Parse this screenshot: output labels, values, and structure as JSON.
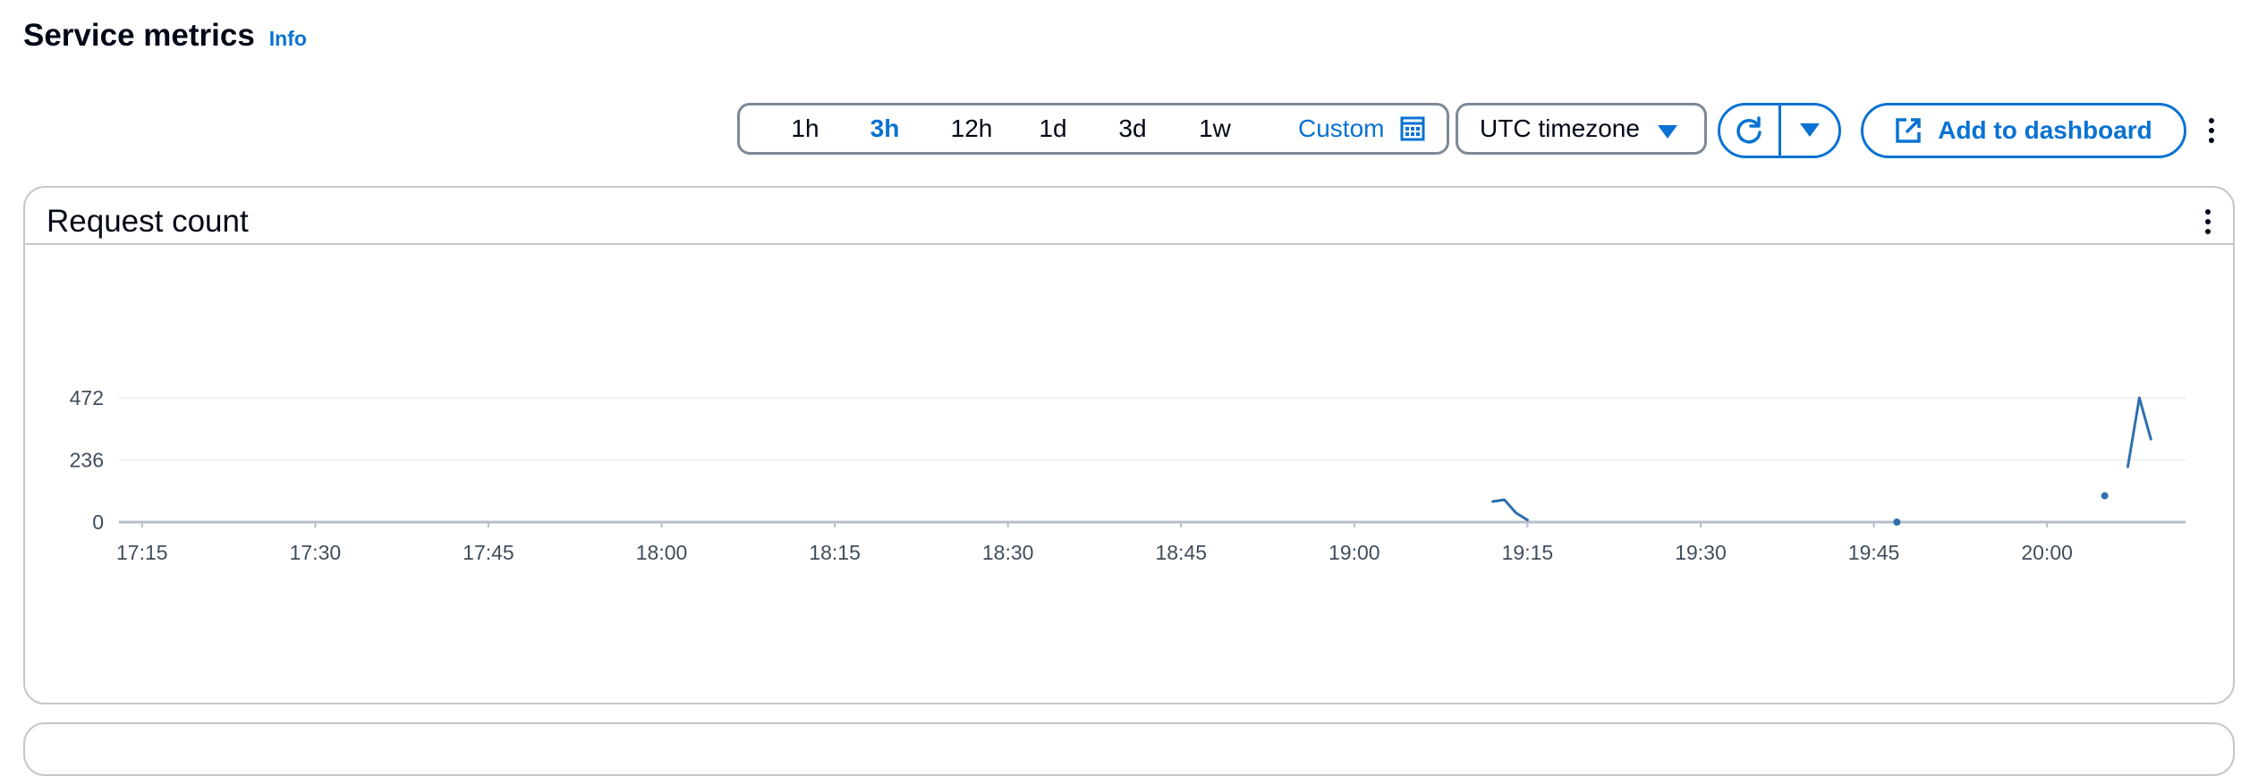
{
  "header": {
    "title": "Service metrics",
    "info": "Info"
  },
  "time_range": {
    "options": [
      "1h",
      "3h",
      "12h",
      "1d",
      "3d",
      "1w"
    ],
    "selected": "3h",
    "custom_label": "Custom"
  },
  "timezone": {
    "value": "UTC timezone"
  },
  "toolbar": {
    "add_to_dashboard": "Add to dashboard"
  },
  "icons": {
    "calendar": "calendar-icon",
    "caret": "caret-down-icon",
    "refresh": "refresh-icon",
    "external": "external-link-icon",
    "more": "more-vertical-icon"
  },
  "colors": {
    "accent": "#0972d3",
    "series": "#2e6fad",
    "border": "#7d8998"
  },
  "widget": {
    "title": "Request count",
    "chart_data": {
      "type": "line",
      "x_ticks": [
        "17:15",
        "17:30",
        "17:45",
        "18:00",
        "18:15",
        "18:30",
        "18:45",
        "19:00",
        "19:15",
        "19:30",
        "19:45",
        "20:00"
      ],
      "y_ticks": [
        "0",
        "236",
        "472"
      ],
      "ylim": [
        0,
        472
      ],
      "xlim": [
        "17:13",
        "20:12"
      ],
      "grid": true,
      "series": [
        {
          "segments": [
            [
              [
                "19:12",
                78
              ],
              [
                "19:13",
                85
              ],
              [
                "19:14",
                35
              ],
              [
                "19:15",
                8
              ]
            ],
            [
              [
                "19:47",
                0
              ]
            ],
            [
              [
                "20:05",
                100
              ]
            ],
            [
              [
                "20:07",
                210
              ],
              [
                "20:08",
                472
              ],
              [
                "20:09",
                315
              ]
            ]
          ]
        }
      ]
    }
  }
}
